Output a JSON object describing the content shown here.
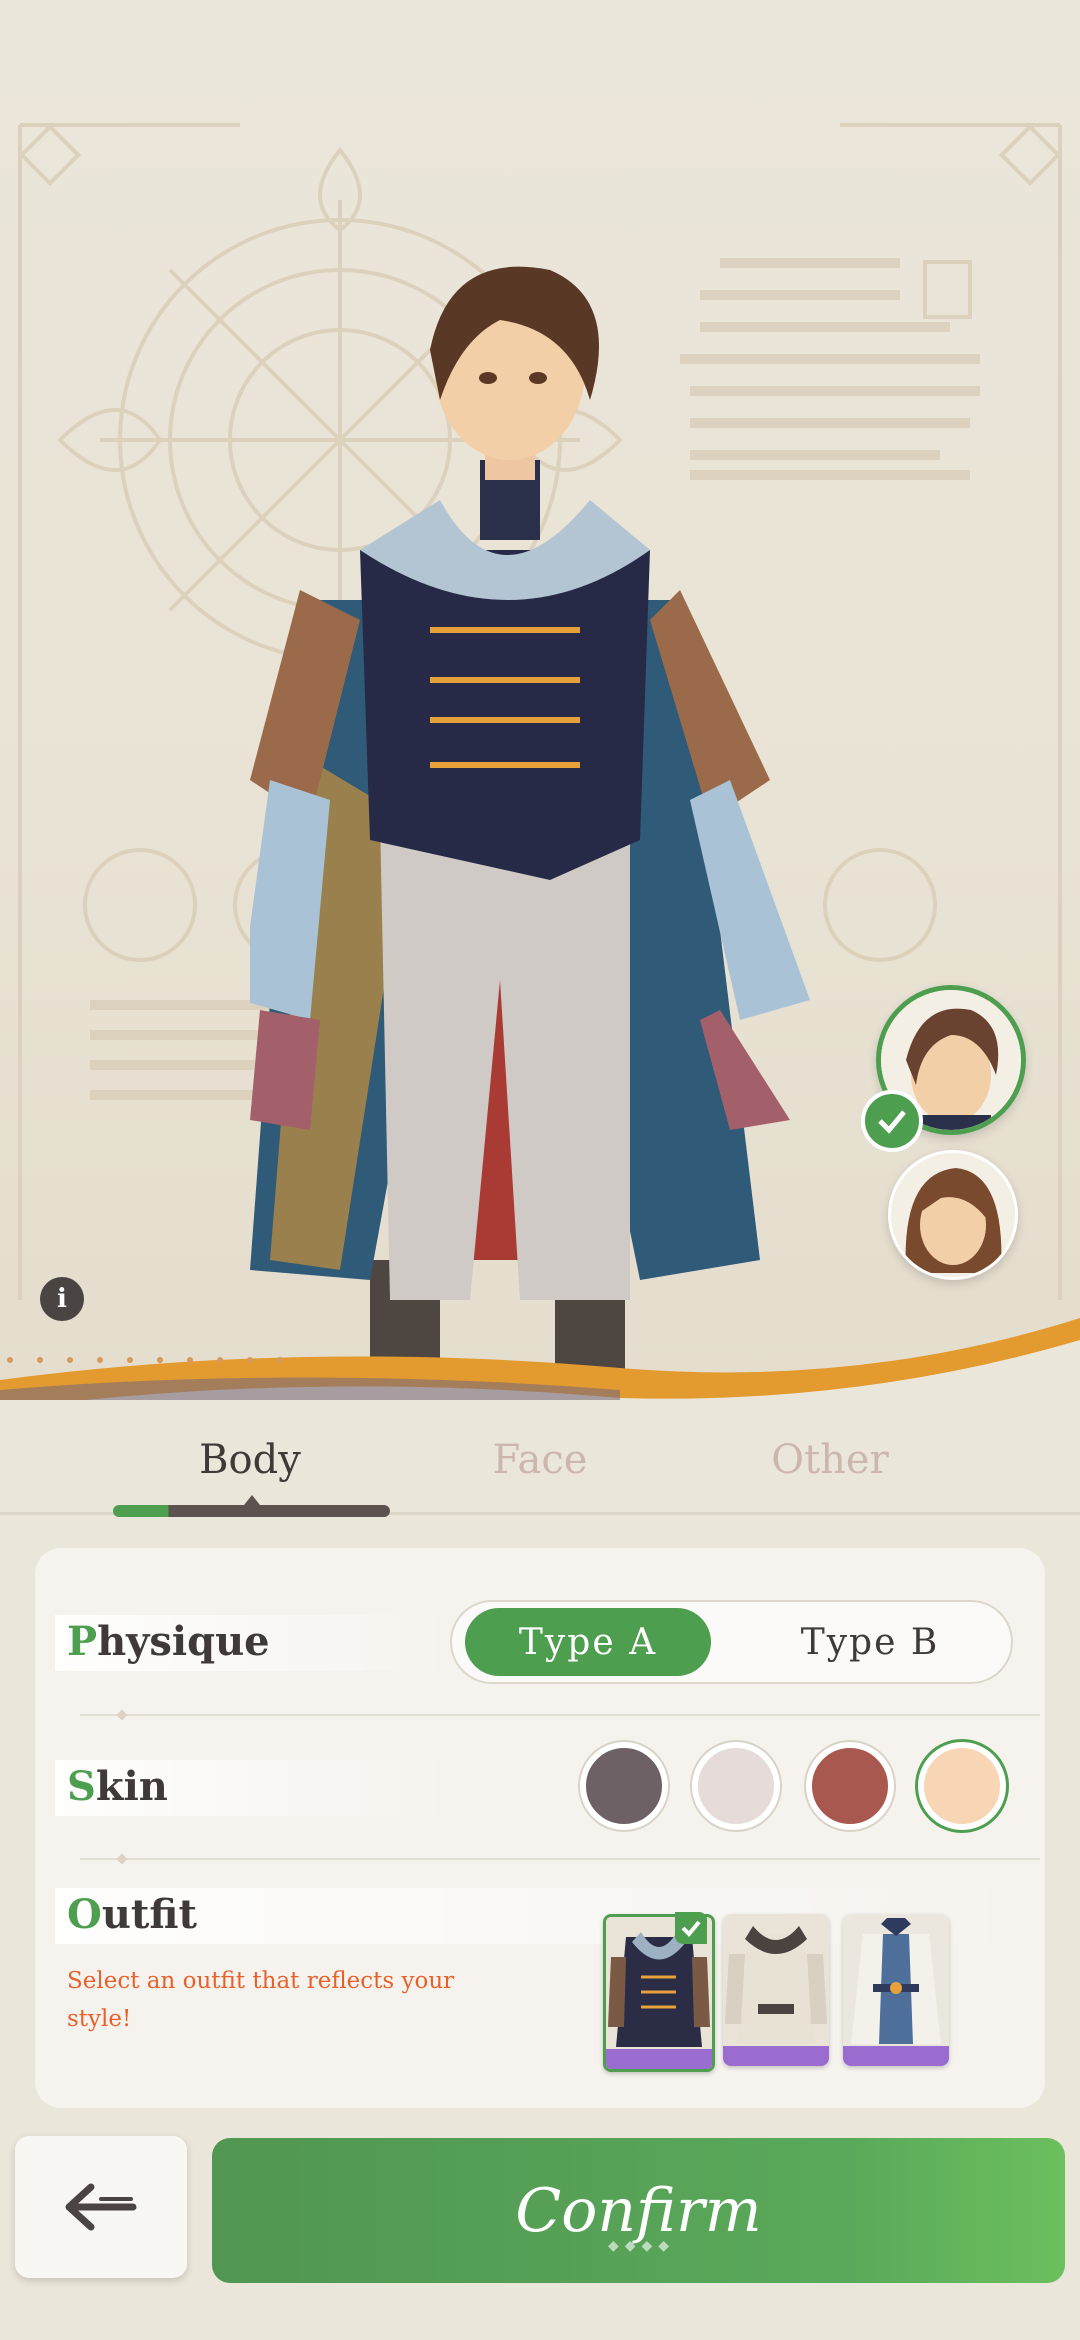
{
  "tabs": [
    {
      "label": "Body",
      "active": true
    },
    {
      "label": "Face",
      "active": false
    },
    {
      "label": "Other",
      "active": false
    }
  ],
  "info_icon": "i",
  "options": {
    "physique": {
      "label_first": "P",
      "label_rest": "hysique",
      "choices": [
        "Type A",
        "Type B"
      ],
      "selected": "Type A"
    },
    "skin": {
      "label_first": "S",
      "label_rest": "kin",
      "colors": [
        "#6e6166",
        "#e5dcda",
        "#a9584f",
        "#f8d6b5"
      ],
      "selected_index": 3
    },
    "outfit": {
      "label_first": "O",
      "label_rest": "utfit",
      "hint": "Select an outfit that reflects your style!",
      "selected_index": 0
    }
  },
  "avatar_options": [
    "male-avatar",
    "female-avatar"
  ],
  "confirm_label": "Confirm",
  "icons": {
    "back": "arrow-left-icon",
    "check": "checkmark-icon",
    "info": "info-icon"
  },
  "colors": {
    "accent_green": "#4e9e4f",
    "hint_orange": "#e8612b",
    "background": "#ebe6da"
  }
}
